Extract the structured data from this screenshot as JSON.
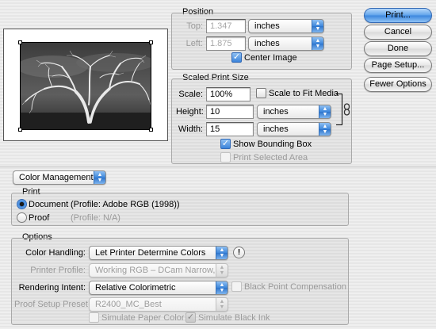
{
  "position": {
    "title": "Position",
    "top_label": "Top:",
    "top_value": "1.347",
    "left_label": "Left:",
    "left_value": "1.875",
    "top_unit": "inches",
    "left_unit": "inches",
    "center_image_label": "Center Image",
    "center_image_checked": true
  },
  "scaled": {
    "title": "Scaled Print Size",
    "scale_label": "Scale:",
    "scale_value": "100%",
    "scale_to_fit_label": "Scale to Fit Media",
    "height_label": "Height:",
    "height_value": "10",
    "height_unit": "inches",
    "width_label": "Width:",
    "width_value": "15",
    "width_unit": "inches",
    "link_icon": "chain-link-icon",
    "show_bbox_label": "Show Bounding Box",
    "show_bbox_checked": true,
    "print_selected_label": "Print Selected Area",
    "print_selected_checked": false
  },
  "buttons": {
    "print": "Print...",
    "cancel": "Cancel",
    "done": "Done",
    "page_setup": "Page Setup...",
    "fewer_options": "Fewer Options"
  },
  "color_mgmt": {
    "dropdown": "Color Management",
    "print_group_title": "Print",
    "document_label": "Document",
    "document_profile": "(Profile: Adobe RGB (1998))",
    "proof_label": "Proof",
    "proof_profile": "(Profile: N/A)",
    "options_title": "Options",
    "color_handling_label": "Color Handling:",
    "color_handling_value": "Let Printer Determine Colors",
    "info_icon": "!",
    "printer_profile_label": "Printer Profile:",
    "printer_profile_value": "Working RGB – DCam Narrow, ...",
    "rendering_intent_label": "Rendering Intent:",
    "rendering_intent_value": "Relative Colorimetric",
    "black_point_label": "Black Point Compensation",
    "proof_setup_label": "Proof Setup Preset:",
    "proof_setup_value": "R2400_MC_Best",
    "simulate_paper_label": "Simulate Paper Color",
    "simulate_black_label": "Simulate Black Ink",
    "simulate_black_checked": true
  },
  "colors": {
    "accent_blue": "#3b84db",
    "default_button": "#5ea2ea",
    "disabled_text": "#9a9a9a"
  }
}
